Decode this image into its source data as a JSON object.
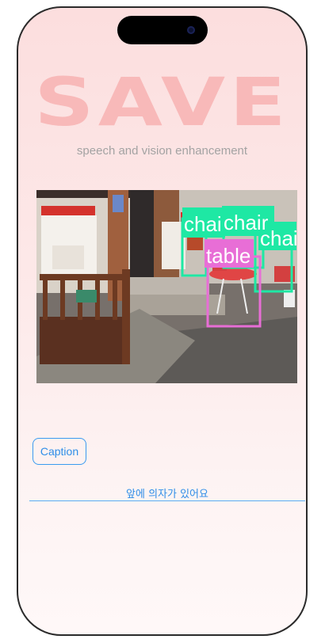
{
  "app": {
    "logo": "SAVE",
    "tagline": "speech and vision enhancement"
  },
  "detections": [
    {
      "label": "chai",
      "color": "#1ee8a4"
    },
    {
      "label": "chair",
      "color": "#1ee8a4"
    },
    {
      "label": "chair",
      "color": "#1ee8a4"
    },
    {
      "label": "table",
      "color": "#e86ed6"
    }
  ],
  "controls": {
    "caption_label": "Caption"
  },
  "result": {
    "text": "앞에 의자가 있어요"
  },
  "colors": {
    "accent": "#2f8ee8",
    "logo": "#f8b9b9",
    "chair_box": "#1ee8a4",
    "table_box": "#e86ed6"
  }
}
